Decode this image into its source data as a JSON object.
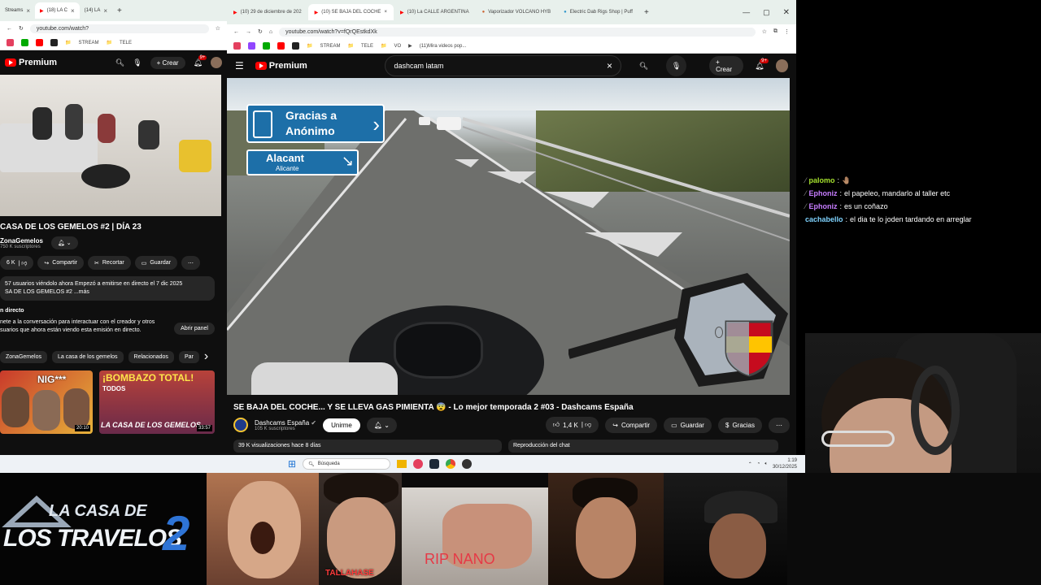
{
  "left_browser": {
    "tabs": [
      {
        "label": "Streams",
        "active": false
      },
      {
        "label": "(18) LA C",
        "active": true
      },
      {
        "label": "(14) LA",
        "active": false
      }
    ],
    "url": "youtube.com/watch?",
    "bookmarks": [
      "STREAM",
      "TELE"
    ],
    "yt_logo": "Premium",
    "crear": "Crear",
    "notif_count": "9+",
    "video_title": "CASA DE LOS GEMELOS #2 | DÍA 23",
    "channel": "ZonaGemelos",
    "subs": "750 K suscriptores",
    "likes": "6 K",
    "share": "Compartir",
    "clip": "Recortar",
    "save": "Guardar",
    "desc_line1": "57 usuarios viéndolo ahora  Empezó a emitirse en directo el 7 dic 2025",
    "desc_line2": "SA DE LOS GEMELOS #2 ...más",
    "live_title": "n directo",
    "live_line1": "nete a la conversación para interactuar con el creador y otros",
    "live_line2": "suarios que ahora están viendo esta emisión en directo.",
    "open_panel": "Abrir panel",
    "chips": [
      "ZonaGemelos",
      "La casa de los gemelos",
      "Relacionados",
      "Par"
    ],
    "thumb1": {
      "caption": "NIG***",
      "duration": "20:10"
    },
    "thumb2": {
      "line1": "¡BOMBAZO TOTAL!",
      "line2": "TODOS",
      "line3": "LA CASA DE LOS GEMELOS",
      "duration": "33:57"
    }
  },
  "right_browser": {
    "tabs": [
      {
        "label": "(10) 29 de diciembre de 202",
        "active": false
      },
      {
        "label": "(10) SE BAJA DEL COCHE",
        "active": true
      },
      {
        "label": "(10) La CALLE ARGENTINA",
        "active": false
      },
      {
        "label": "Vaporizador VOLCANO HYB",
        "active": false
      },
      {
        "label": "Electric Dab Rigs Shop | Puff",
        "active": false
      }
    ],
    "url": "youtube.com/watch?v=fQrQEstkdXk",
    "bookmarks": [
      "STREAM",
      "TELE",
      "VO",
      "(11)Mira videos pop..."
    ],
    "yt_logo": "Premium",
    "search_value": "dashcam latam",
    "crear": "Crear",
    "notif_count": "9+",
    "sign1_line1": "Gracias a",
    "sign1_line2": "Anónimo",
    "sign2_line1": "Alacant",
    "sign2_line2": "Alicante",
    "video_title": "SE BAJA DEL COCHE... Y SE LLEVA GAS PIMIENTA 😨 - Lo mejor temporada 2 #03 - Dashcams España",
    "channel": "Dashcams España",
    "subs": "105 K suscriptores",
    "join": "Unirme",
    "likes": "1,4 K",
    "share": "Compartir",
    "save": "Guardar",
    "thanks": "Gracias",
    "views": "39 K visualizaciones  hace 8 días",
    "chat_replay": "Reproducción del chat"
  },
  "taskbar": {
    "search_placeholder": "Búsqueda",
    "time": "1:19",
    "date": "30/12/2025"
  },
  "chat": [
    {
      "user": "palomo",
      "text": "🤚🏽",
      "color": "#a6e22e"
    },
    {
      "user": "Ephoniz",
      "text": "el papeleo, mandarlo al taller etc",
      "color": "#c77dff"
    },
    {
      "user": "Ephoniz",
      "text": "es un coñazo",
      "color": "#c77dff"
    },
    {
      "user": "cachabello",
      "text": "el dia te lo joden tardando en arreglar",
      "color": "#7fd3ff"
    }
  ],
  "bottom": {
    "logo_line1": "LA CASA DE",
    "logo_line2": "LOS TRAVELOS",
    "logo_number": "2",
    "caption_tallahase": "TALLAHASE",
    "caption_rip": "RIP NANO"
  }
}
